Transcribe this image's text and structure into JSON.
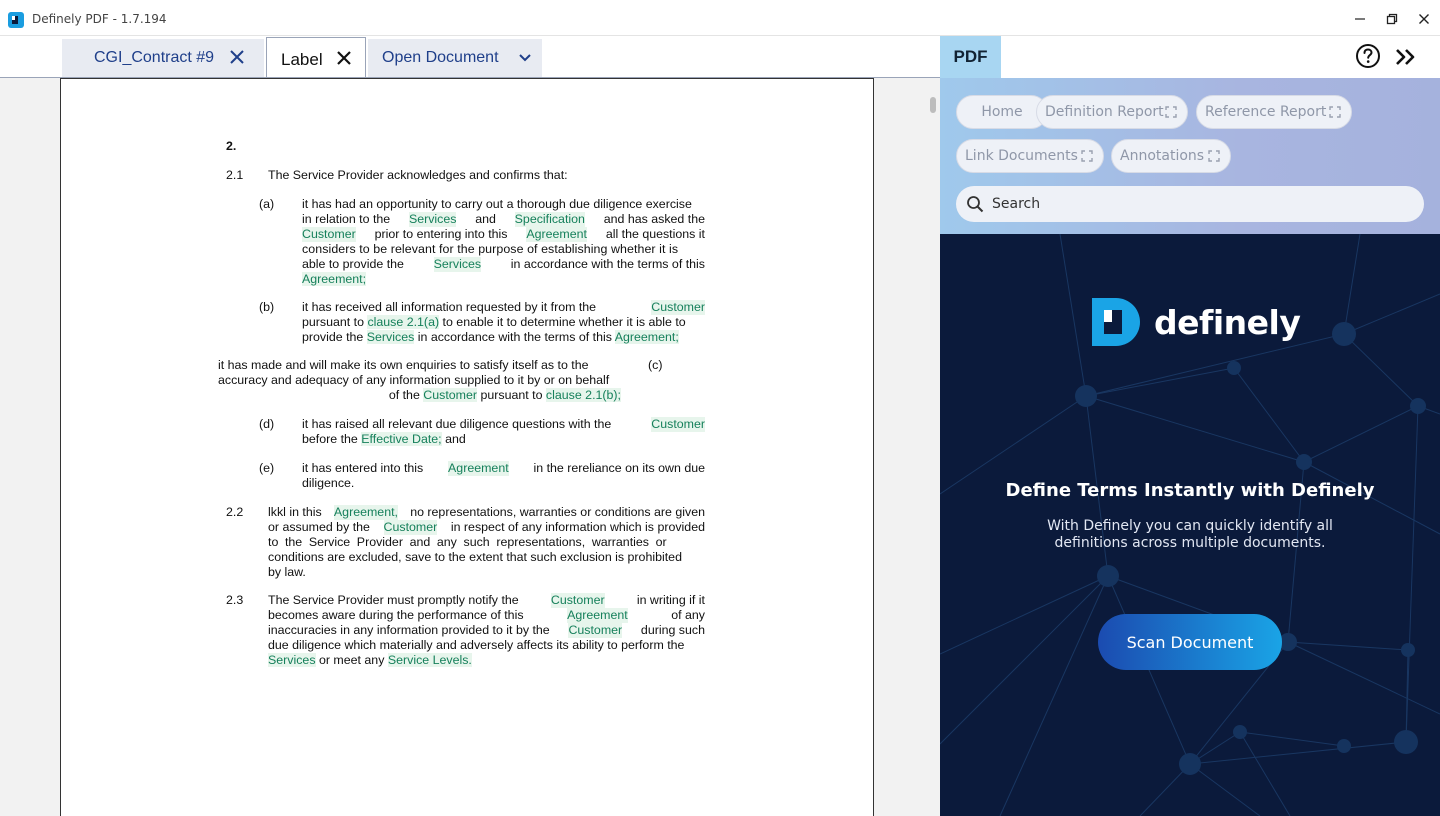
{
  "window": {
    "title": "Definely PDF - 1.7.194",
    "minimize_icon": "minimize-icon",
    "maximize_icon": "restore-icon",
    "close_icon": "close-icon"
  },
  "tabs": [
    {
      "label": "CGI_Contract #9",
      "icon": "close-icon",
      "active": false
    },
    {
      "label": "Label",
      "icon": "close-icon",
      "active": true
    },
    {
      "label": "Open Document",
      "icon": "chevron-down-icon",
      "active": false
    }
  ],
  "document": {
    "section": "2.",
    "c21_num": "2.1",
    "c21_text": "The Service Provider acknowledges and confirms that:",
    "a_label": "(a)",
    "a_l1": "it has had an opportunity to carry out a thorough due diligence exercise",
    "a_l2_pre": "in relation to the",
    "a_l2_t1": "Services",
    "a_l2_mid": "and",
    "a_l2_t2": "Specification",
    "a_l2_post": "and has asked the",
    "a_l3_t1": "Customer",
    "a_l3_mid": "prior to entering into this",
    "a_l3_t2": "Agreement",
    "a_l3_post": "all the questions it",
    "a_l4": "considers to be relevant for the purpose of establishing whether it is",
    "a_l5_pre": "able to provide the",
    "a_l5_t1": "Services",
    "a_l5_post": "in accordance with the terms of this",
    "a_l6_t1": "Agreement;",
    "b_label": "(b)",
    "b_l1_pre": "it has received all information requested by it from the",
    "b_l1_t1": "Customer",
    "b_l2_pre": "pursuant to",
    "b_l2_t1": "clause 2.1(a)",
    "b_l2_post": " to enable it to determine whether it is able to",
    "b_l3_pre": "provide the",
    "b_l3_t1": "Services",
    "b_l3_mid": "in accordance with the terms of this",
    "b_l3_t2": "Agreement;",
    "c_label": "(c)",
    "c_l1": "it has made and will make its own enquiries to satisfy itself as to the",
    "c_l2": "accuracy and adequacy of any information supplied to it by or on behalf",
    "c_l3_pre": "of the",
    "c_l3_t1": "Customer",
    "c_l3_mid": "pursuant to",
    "c_l3_t2": "clause 2.1(b);",
    "d_label": "(d)",
    "d_l1_pre": "it has raised all relevant due diligence questions with the",
    "d_l1_t1": "Customer",
    "d_l2_pre": "before the",
    "d_l2_t1": "Effective Date;",
    "d_l2_post": "and",
    "e_label": "(e)",
    "e_l1_pre": "it has entered into this",
    "e_l1_t1": "Agreement",
    "e_l1_post": "in the rereliance on its own due",
    "e_l2": "diligence.",
    "c22_num": "2.2",
    "c22_l1_pre": "lkkl in this",
    "c22_l1_t1": "Agreement,",
    "c22_l1_post": "no representations, warranties or conditions are given",
    "c22_l2_pre": "or assumed by the",
    "c22_l2_t1": "Customer",
    "c22_l2_post": "in respect of any information which is provided",
    "c22_l3": "to the Service Provider and any such representations, warranties or",
    "c22_l4": "conditions are excluded, save to the extent that such exclusion is prohibited",
    "c22_l5": "by law.",
    "c23_num": "2.3",
    "c23_l1_pre": "The Service Provider must promptly notify the",
    "c23_l1_t1": "Customer",
    "c23_l1_post": "in writing if it",
    "c23_l2_pre": "becomes aware during the performance of this",
    "c23_l2_t1": "Agreement",
    "c23_l2_post": "of any",
    "c23_l3_pre": "inaccuracies in any information provided to it by the",
    "c23_l3_t1": "Customer",
    "c23_l3_post": "during such",
    "c23_l4": "due diligence which materially and adversely affects its ability to perform the",
    "c23_l5_t1": "Services",
    "c23_l5_mid": "or meet any",
    "c23_l5_t2": "Service Levels."
  },
  "panel": {
    "tab_label": "PDF",
    "help_icon": "help-circle-icon",
    "collapse_icon": "double-chevron-right-icon",
    "nav": {
      "home": "Home",
      "definition_report": "Definition Report",
      "reference_report": "Reference Report",
      "link_documents": "Link Documents",
      "annotations": "Annotations"
    },
    "search_placeholder": "Search",
    "brand_name": "definely",
    "headline": "Define Terms Instantly with Definely",
    "subline": "With Definely you can quickly identify all definitions across multiple documents.",
    "scan_button": "Scan Document",
    "colors": {
      "accent": "#1aa4e6",
      "panel_bg": "#0b1a3b",
      "highlight_text": "#16805b",
      "tab_text": "#1f3f8a"
    }
  }
}
